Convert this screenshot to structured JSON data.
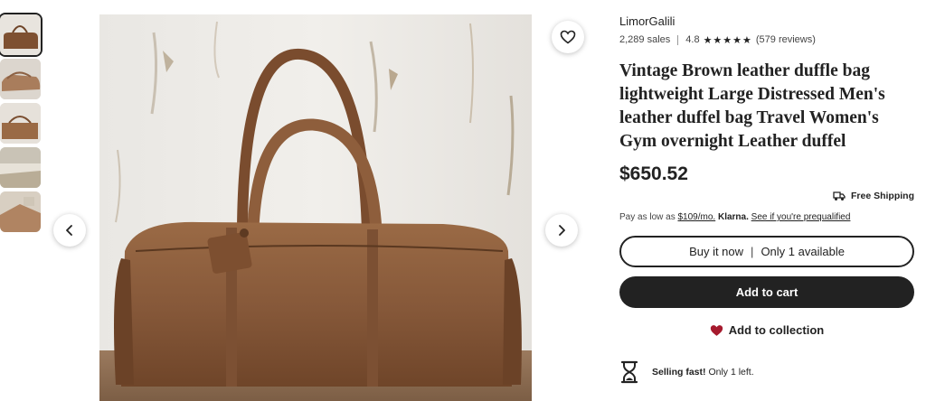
{
  "gallery": {
    "thumbnails": [
      {
        "alt": "thumbnail 1"
      },
      {
        "alt": "thumbnail 2"
      },
      {
        "alt": "thumbnail 3"
      },
      {
        "alt": "thumbnail 4"
      },
      {
        "alt": "thumbnail 5"
      }
    ],
    "prev_symbol": "‹",
    "next_symbol": "›"
  },
  "listing": {
    "shop_name": "LimorGalili",
    "sales": "2,289 sales",
    "rating": "4.8",
    "stars": "★★★★★",
    "reviews": "(579 reviews)",
    "title": "Vintage Brown leather duffle bag lightweight Large Distressed Men's leather duffel bag Travel Women's Gym overnight Leather duffel",
    "price": "$650.52",
    "shipping": "Free Shipping",
    "klarna": {
      "prefix": "Pay as low as",
      "amount": "$109/mo.",
      "brand": "Klarna.",
      "link": "See if you're prequalified"
    },
    "buy_label": "Buy it now",
    "buy_divider": "|",
    "availability": "Only 1 available",
    "cart_label": "Add to cart",
    "collection_label": "Add to collection",
    "selling_bold": "Selling fast!",
    "selling_rest": "Only 1 left."
  },
  "colors": {
    "leather": "#8a5a36",
    "heart": "#a61a2e",
    "dark": "#222222"
  }
}
